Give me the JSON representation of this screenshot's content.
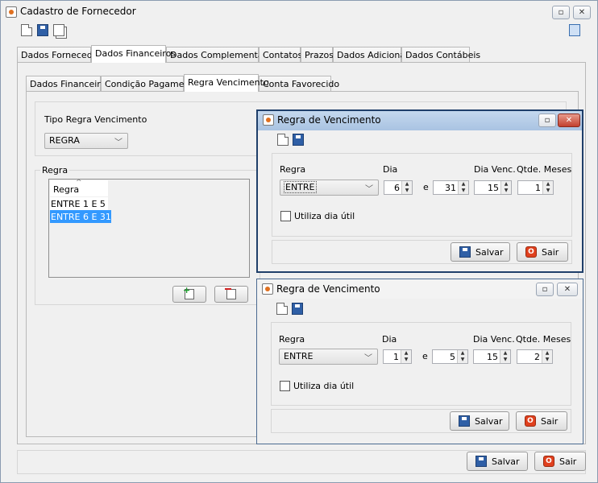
{
  "main": {
    "title": "Cadastro de Fornecedor",
    "tabs": [
      "Dados Fornecedor",
      "Dados Financeiros",
      "Dados Complementares",
      "Contatos",
      "Prazos",
      "Dados Adicionais",
      "Dados Contábeis"
    ],
    "subtabs": [
      "Dados Financeiros",
      "Condição Pagamento",
      "Regra Vencimento",
      "Conta Favorecido"
    ],
    "tipo_regra_label": "Tipo Regra Vencimento",
    "tipo_regra_value": "REGRA",
    "regra_group_label": "Regra",
    "regra_column": "Regra",
    "regra_rows": [
      "ENTRE 1 E 5",
      "ENTRE 6 E 31"
    ],
    "save_label": "Salvar",
    "exit_label": "Sair"
  },
  "dialog1": {
    "title": "Regra de Vencimento",
    "regra_label": "Regra",
    "dia_label": "Dia",
    "dia_venc_label": "Dia Venc.",
    "qtde_meses_label": "Qtde. Meses",
    "regra_value": "ENTRE",
    "dia_from": "6",
    "e_label": "e",
    "dia_to": "31",
    "dia_venc": "15",
    "qtde_meses": "1",
    "utiliza_label": "Utiliza dia útil",
    "save_label": "Salvar",
    "exit_label": "Sair"
  },
  "dialog2": {
    "title": "Regra de Vencimento",
    "regra_label": "Regra",
    "dia_label": "Dia",
    "dia_venc_label": "Dia Venc.",
    "qtde_meses_label": "Qtde. Meses",
    "regra_value": "ENTRE",
    "dia_from": "1",
    "e_label": "e",
    "dia_to": "5",
    "dia_venc": "15",
    "qtde_meses": "2",
    "utiliza_label": "Utiliza dia útil",
    "save_label": "Salvar",
    "exit_label": "Sair"
  },
  "window_buttons": {
    "restore": "▫",
    "close": "✕"
  },
  "icons": {
    "exit_glyph": "O"
  }
}
